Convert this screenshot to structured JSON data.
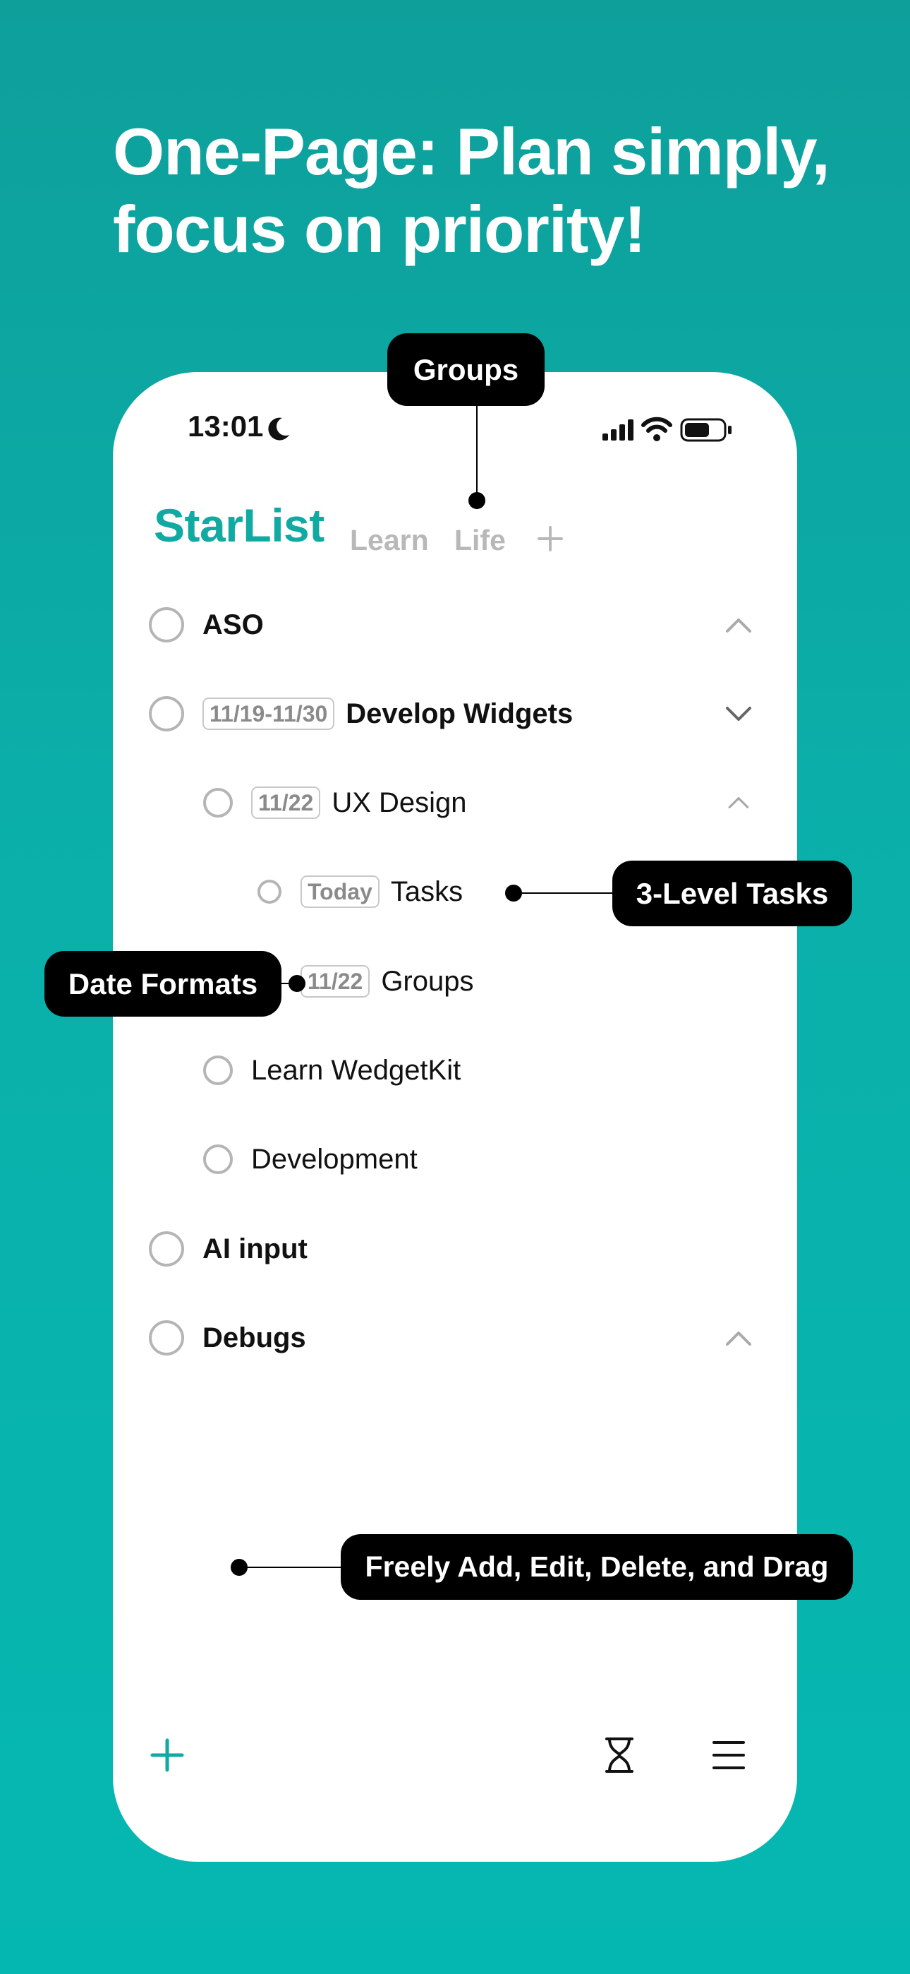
{
  "headline": [
    "One-Page: Plan simply,",
    "focus on priority!"
  ],
  "status_bar": {
    "time": "13:01"
  },
  "app": {
    "title": "StarList",
    "tabs": [
      "Learn",
      "Life"
    ]
  },
  "tasks": {
    "aso": {
      "label": "ASO"
    },
    "develop_widgets": {
      "date": "11/19-11/30",
      "label": "Develop Widgets"
    },
    "ux_design": {
      "date": "11/22",
      "label": "UX Design"
    },
    "tasks_item": {
      "date": "Today",
      "label": "Tasks"
    },
    "groups_item": {
      "date": "11/22",
      "label": "Groups"
    },
    "learn_widgetkit": {
      "label": "Learn WedgetKit"
    },
    "development": {
      "label": "Development"
    },
    "ai_input": {
      "label": "AI input"
    },
    "debugs": {
      "label": "Debugs"
    }
  },
  "callouts": {
    "groups": "Groups",
    "three_level": "3-Level Tasks",
    "date_formats": "Date Formats",
    "freely_add": "Freely Add, Edit, Delete, and Drag"
  },
  "colors": {
    "accent": "#10aaa3",
    "background_top": "#0e9f9b",
    "background_bottom": "#05b7b1",
    "callout": "#000000"
  },
  "icons": [
    "moon-icon",
    "cellular-signal-icon",
    "wifi-icon",
    "battery-icon",
    "plus-icon",
    "chevron-up-icon",
    "chevron-down-icon",
    "hourglass-icon",
    "menu-icon"
  ]
}
